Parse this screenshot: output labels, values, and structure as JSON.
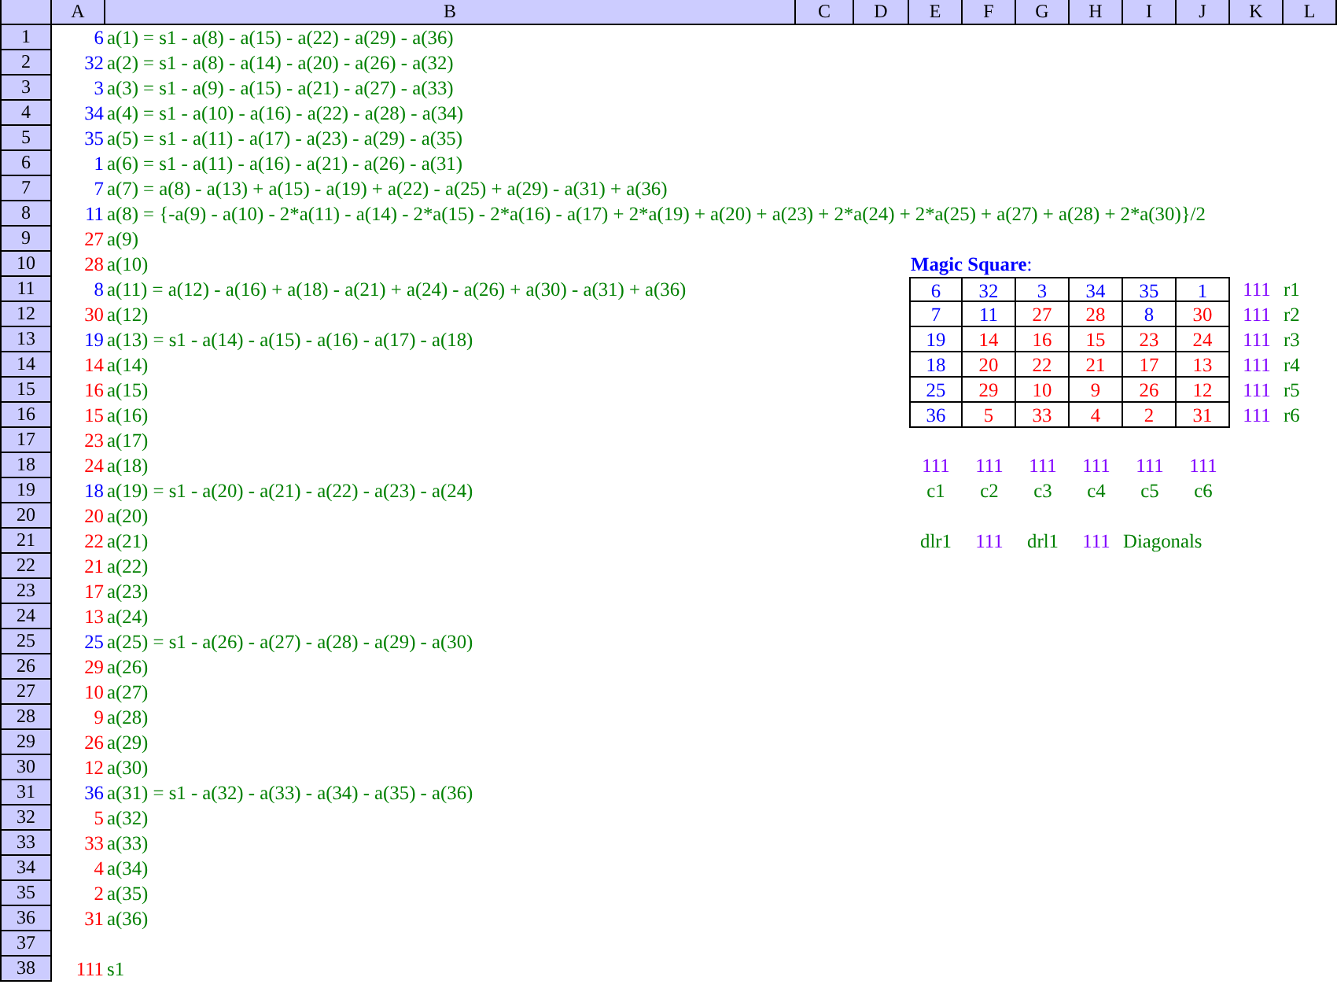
{
  "sheet": {
    "columns": [
      "A",
      "B",
      "C",
      "D",
      "E",
      "F",
      "G",
      "H",
      "I",
      "J",
      "K",
      "L"
    ],
    "row_numbers": [
      "1",
      "2",
      "3",
      "4",
      "5",
      "6",
      "7",
      "8",
      "9",
      "10",
      "11",
      "12",
      "13",
      "14",
      "15",
      "16",
      "17",
      "18",
      "19",
      "20",
      "21",
      "22",
      "23",
      "24",
      "25",
      "26",
      "27",
      "28",
      "29",
      "30",
      "31",
      "32",
      "33",
      "34",
      "35",
      "36",
      "37",
      "38"
    ]
  },
  "rows": [
    {
      "value": "6",
      "color": "#0000ff",
      "formula": "a(1) = s1 - a(8) - a(15) - a(22) - a(29) - a(36)"
    },
    {
      "value": "32",
      "color": "#0000ff",
      "formula": "a(2) = s1 - a(8) - a(14) - a(20) - a(26) - a(32)"
    },
    {
      "value": "3",
      "color": "#0000ff",
      "formula": "a(3) = s1 - a(9) - a(15) - a(21) - a(27) - a(33)"
    },
    {
      "value": "34",
      "color": "#0000ff",
      "formula": "a(4) = s1 - a(10) - a(16) - a(22) - a(28) - a(34)"
    },
    {
      "value": "35",
      "color": "#0000ff",
      "formula": "a(5) = s1 - a(11) - a(17) - a(23) - a(29) - a(35)"
    },
    {
      "value": "1",
      "color": "#0000ff",
      "formula": "a(6) = s1 - a(11) - a(16) - a(21) - a(26) - a(31)"
    },
    {
      "value": "7",
      "color": "#0000ff",
      "formula": "a(7) = a(8) - a(13) + a(15) - a(19) + a(22) - a(25) + a(29) - a(31) + a(36)"
    },
    {
      "value": "11",
      "color": "#0000ff",
      "formula": "a(8) = {-a(9) - a(10) - 2*a(11) - a(14) - 2*a(15) - 2*a(16) - a(17) + 2*a(19) + a(20) + a(23) + 2*a(24) + 2*a(25) + a(27) + a(28) + 2*a(30)}/2"
    },
    {
      "value": "27",
      "color": "#ff0000",
      "formula": "a(9)"
    },
    {
      "value": "28",
      "color": "#ff0000",
      "formula": "a(10)"
    },
    {
      "value": "8",
      "color": "#0000ff",
      "formula": "a(11) = a(12) - a(16) + a(18) - a(21) + a(24) - a(26) + a(30) - a(31) + a(36)"
    },
    {
      "value": "30",
      "color": "#ff0000",
      "formula": "a(12)"
    },
    {
      "value": "19",
      "color": "#0000ff",
      "formula": "a(13) = s1 - a(14) - a(15) - a(16) - a(17) - a(18)"
    },
    {
      "value": "14",
      "color": "#ff0000",
      "formula": "a(14)"
    },
    {
      "value": "16",
      "color": "#ff0000",
      "formula": "a(15)"
    },
    {
      "value": "15",
      "color": "#ff0000",
      "formula": "a(16)"
    },
    {
      "value": "23",
      "color": "#ff0000",
      "formula": "a(17)"
    },
    {
      "value": "24",
      "color": "#ff0000",
      "formula": "a(18)"
    },
    {
      "value": "18",
      "color": "#0000ff",
      "formula": "a(19) = s1 - a(20) - a(21) - a(22) - a(23) - a(24)"
    },
    {
      "value": "20",
      "color": "#ff0000",
      "formula": "a(20)"
    },
    {
      "value": "22",
      "color": "#ff0000",
      "formula": "a(21)"
    },
    {
      "value": "21",
      "color": "#ff0000",
      "formula": "a(22)"
    },
    {
      "value": "17",
      "color": "#ff0000",
      "formula": "a(23)"
    },
    {
      "value": "13",
      "color": "#ff0000",
      "formula": "a(24)"
    },
    {
      "value": "25",
      "color": "#0000ff",
      "formula": "a(25) = s1 - a(26) - a(27) - a(28) - a(29) - a(30)"
    },
    {
      "value": "29",
      "color": "#ff0000",
      "formula": "a(26)"
    },
    {
      "value": "10",
      "color": "#ff0000",
      "formula": "a(27)"
    },
    {
      "value": "9",
      "color": "#ff0000",
      "formula": "a(28)"
    },
    {
      "value": "26",
      "color": "#ff0000",
      "formula": "a(29)"
    },
    {
      "value": "12",
      "color": "#ff0000",
      "formula": "a(30)"
    },
    {
      "value": "36",
      "color": "#0000ff",
      "formula": "a(31) = s1 - a(32) - a(33) - a(34) - a(35) - a(36)"
    },
    {
      "value": "5",
      "color": "#ff0000",
      "formula": "a(32)"
    },
    {
      "value": "33",
      "color": "#ff0000",
      "formula": "a(33)"
    },
    {
      "value": "4",
      "color": "#ff0000",
      "formula": "a(34)"
    },
    {
      "value": "2",
      "color": "#ff0000",
      "formula": "a(35)"
    },
    {
      "value": "31",
      "color": "#ff0000",
      "formula": "a(36)"
    }
  ],
  "sum": {
    "value": "111",
    "color": "#ff0000",
    "label": "s1"
  },
  "magic_square": {
    "title": "**Magic Square**:",
    "rows": [
      {
        "cells": [
          {
            "value": "6",
            "color": "#0000ff"
          },
          {
            "value": "32",
            "color": "#0000ff"
          },
          {
            "value": "3",
            "color": "#0000ff"
          },
          {
            "value": "34",
            "color": "#0000ff"
          },
          {
            "value": "35",
            "color": "#0000ff"
          },
          {
            "value": "1",
            "color": "#0000ff"
          }
        ],
        "total": "111",
        "label": "r1"
      },
      {
        "cells": [
          {
            "value": "7",
            "color": "#0000ff"
          },
          {
            "value": "11",
            "color": "#0000ff"
          },
          {
            "value": "27",
            "color": "#ff0000"
          },
          {
            "value": "28",
            "color": "#ff0000"
          },
          {
            "value": "8",
            "color": "#0000ff"
          },
          {
            "value": "30",
            "color": "#ff0000"
          }
        ],
        "total": "111",
        "label": "r2"
      },
      {
        "cells": [
          {
            "value": "19",
            "color": "#0000ff"
          },
          {
            "value": "14",
            "color": "#ff0000"
          },
          {
            "value": "16",
            "color": "#ff0000"
          },
          {
            "value": "15",
            "color": "#ff0000"
          },
          {
            "value": "23",
            "color": "#ff0000"
          },
          {
            "value": "24",
            "color": "#ff0000"
          }
        ],
        "total": "111",
        "label": "r3"
      },
      {
        "cells": [
          {
            "value": "18",
            "color": "#0000ff"
          },
          {
            "value": "20",
            "color": "#ff0000"
          },
          {
            "value": "22",
            "color": "#ff0000"
          },
          {
            "value": "21",
            "color": "#ff0000"
          },
          {
            "value": "17",
            "color": "#ff0000"
          },
          {
            "value": "13",
            "color": "#ff0000"
          }
        ],
        "total": "111",
        "label": "r4"
      },
      {
        "cells": [
          {
            "value": "25",
            "color": "#0000ff"
          },
          {
            "value": "29",
            "color": "#ff0000"
          },
          {
            "value": "10",
            "color": "#ff0000"
          },
          {
            "value": "9",
            "color": "#ff0000"
          },
          {
            "value": "26",
            "color": "#ff0000"
          },
          {
            "value": "12",
            "color": "#ff0000"
          }
        ],
        "total": "111",
        "label": "r5"
      },
      {
        "cells": [
          {
            "value": "36",
            "color": "#0000ff"
          },
          {
            "value": "5",
            "color": "#ff0000"
          },
          {
            "value": "33",
            "color": "#ff0000"
          },
          {
            "value": "4",
            "color": "#ff0000"
          },
          {
            "value": "2",
            "color": "#ff0000"
          },
          {
            "value": "31",
            "color": "#ff0000"
          }
        ],
        "total": "111",
        "label": "r6"
      }
    ],
    "column_totals": [
      {
        "total": "111",
        "label": "c1"
      },
      {
        "total": "111",
        "label": "c2"
      },
      {
        "total": "111",
        "label": "c3"
      },
      {
        "total": "111",
        "label": "c4"
      },
      {
        "total": "111",
        "label": "c5"
      },
      {
        "total": "111",
        "label": "c6"
      }
    ],
    "diagonals": [
      {
        "label": "dlr1",
        "total": "111"
      },
      {
        "label": "drl1",
        "total": "111"
      }
    ],
    "diagonals_label": "Diagonals"
  }
}
